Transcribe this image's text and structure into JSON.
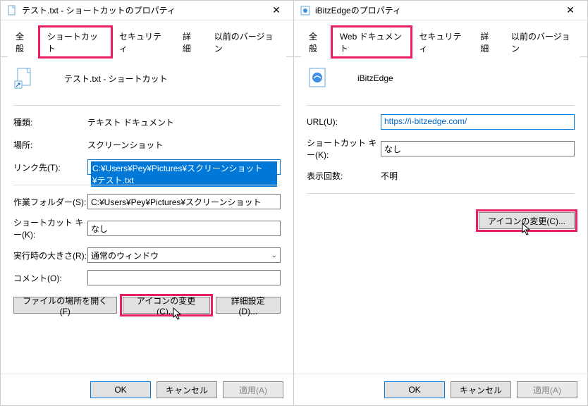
{
  "left": {
    "title": "テスト.txt - ショートカットのプロパティ",
    "tabs": {
      "general": "全般",
      "shortcut": "ショートカット",
      "security": "セキュリティ",
      "details": "詳細",
      "previous": "以前のバージョン"
    },
    "name": "テスト.txt - ショートカット",
    "kind_label": "種類:",
    "kind_value": "テキスト ドキュメント",
    "location_label": "場所:",
    "location_value": "スクリーンショット",
    "target_label": "リンク先(T):",
    "target_value": "C:¥Users¥Pey¥Pictures¥スクリーンショット¥テスト.txt",
    "startin_label": "作業フォルダー(S):",
    "startin_value": "C:¥Users¥Pey¥Pictures¥スクリーンショット",
    "hotkey_label": "ショートカット キー(K):",
    "hotkey_value": "なし",
    "run_label": "実行時の大きさ(R):",
    "run_value": "通常のウィンドウ",
    "comment_label": "コメント(O):",
    "comment_value": "",
    "openloc_btn": "ファイルの場所を開く(F)",
    "changeicon_btn": "アイコンの変更(C)...",
    "advanced_btn": "詳細設定(D)..."
  },
  "right": {
    "title": "iBitzEdgeのプロパティ",
    "tabs": {
      "general": "全般",
      "webdoc": "Web ドキュメント",
      "security": "セキュリティ",
      "details": "詳細",
      "previous": "以前のバージョン"
    },
    "name": "iBitzEdge",
    "url_label": "URL(U):",
    "url_value": "https://i-bitzedge.com/",
    "hotkey_label": "ショートカット キー(K):",
    "hotkey_value": "なし",
    "visits_label": "表示回数:",
    "visits_value": "不明",
    "changeicon_btn": "アイコンの変更(C)..."
  },
  "footer": {
    "ok": "OK",
    "cancel": "キャンセル",
    "apply": "適用(A)"
  }
}
